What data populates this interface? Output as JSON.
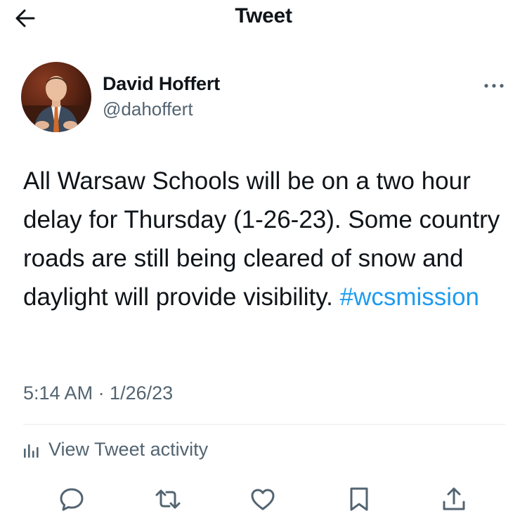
{
  "header": {
    "title": "Tweet",
    "back_icon": "arrow-left-icon"
  },
  "author": {
    "name": "David Hoffert",
    "handle": "@dahoffert",
    "more_icon": "more-horizontal-icon"
  },
  "tweet": {
    "text": "All Warsaw Schools will be on a two hour delay for Thursday (1-26-23). Some country roads are still being cleared of snow and daylight will provide visibility. ",
    "hashtag": "#wcsmission",
    "timestamp": "5:14 AM · 1/26/23"
  },
  "activity": {
    "label": "View Tweet activity",
    "icon": "bar-chart-icon"
  },
  "actions": [
    {
      "name": "reply",
      "icon": "reply-icon"
    },
    {
      "name": "retweet",
      "icon": "retweet-icon"
    },
    {
      "name": "like",
      "icon": "heart-icon"
    },
    {
      "name": "bookmark",
      "icon": "bookmark-icon"
    },
    {
      "name": "share",
      "icon": "share-icon"
    }
  ],
  "colors": {
    "text": "#0f1419",
    "secondary": "#536471",
    "link": "#1d9bf0",
    "divider": "#e6ecf0"
  }
}
